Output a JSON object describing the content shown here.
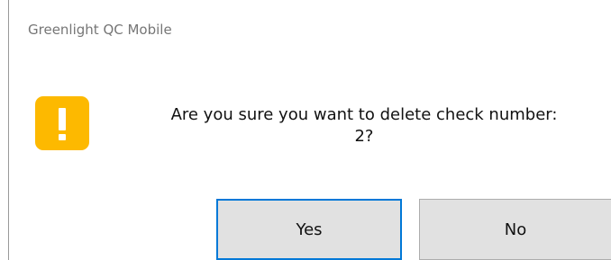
{
  "dialog": {
    "title": "Greenlight QC Mobile",
    "icon": "warning-exclamation-icon",
    "accent_color": "#FDB900",
    "message_line1": "Are you sure you want to delete check number:",
    "message_line2": "2?"
  },
  "buttons": {
    "yes_label": "Yes",
    "no_label": "No",
    "focus_color": "#0078D7"
  }
}
